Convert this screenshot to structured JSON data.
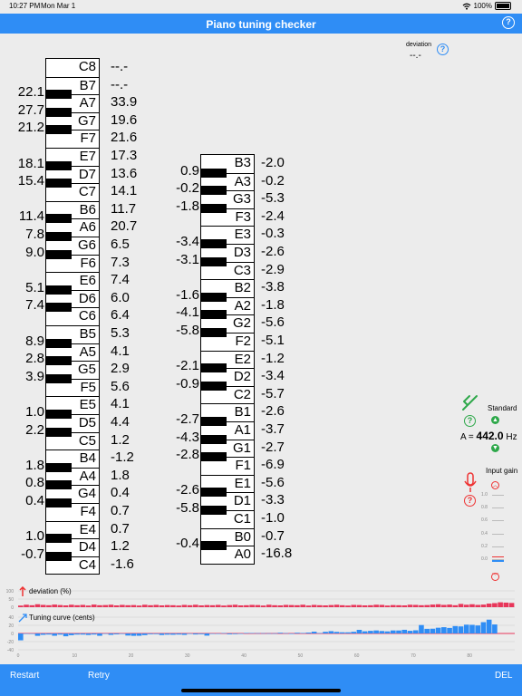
{
  "status_bar": {
    "time": "10:27 PM",
    "date": "Mon Mar 1",
    "battery": "100%"
  },
  "title": "Piano tuning checker",
  "help_symbol": "?",
  "deviation": {
    "label": "deviation",
    "value": "--.-"
  },
  "column1": {
    "keys": [
      "C8",
      "B7",
      "A7",
      "G7",
      "F7",
      "E7",
      "D7",
      "C7",
      "B6",
      "A6",
      "G6",
      "F6",
      "E6",
      "D6",
      "C6",
      "B5",
      "A5",
      "G5",
      "F5",
      "E5",
      "D5",
      "C5",
      "B4",
      "A4",
      "G4",
      "F4",
      "E4",
      "D4",
      "C4"
    ],
    "white_values": [
      "--.-",
      "--.-",
      "33.9",
      "19.6",
      "21.6",
      "17.3",
      "13.6",
      "14.1",
      "11.7",
      "20.7",
      "6.5",
      "7.3",
      "7.4",
      "6.0",
      "6.4",
      "5.3",
      "4.1",
      "2.9",
      "5.6",
      "4.1",
      "4.4",
      "1.2",
      "-1.2",
      "1.8",
      "0.4",
      "0.7",
      "0.7",
      "1.2",
      "-1.6"
    ],
    "black_values": [
      "22.1",
      "27.7",
      "21.2",
      "18.1",
      "15.4",
      "11.4",
      "7.8",
      "9.0",
      "5.1",
      "7.4",
      "8.9",
      "2.8",
      "3.9",
      "1.0",
      "2.2",
      "1.8",
      "0.8",
      "0.4",
      "1.0",
      "-0.7"
    ]
  },
  "column2": {
    "keys": [
      "B3",
      "A3",
      "G3",
      "F3",
      "E3",
      "D3",
      "C3",
      "B2",
      "A2",
      "G2",
      "F2",
      "E2",
      "D2",
      "C2",
      "B1",
      "A1",
      "G1",
      "F1",
      "E1",
      "D1",
      "C1",
      "B0",
      "A0"
    ],
    "white_values": [
      "-2.0",
      "-0.2",
      "-5.3",
      "-2.4",
      "-0.3",
      "-2.6",
      "-2.9",
      "-3.8",
      "-1.8",
      "-5.6",
      "-5.1",
      "-1.2",
      "-3.4",
      "-5.7",
      "-2.6",
      "-3.7",
      "-2.7",
      "-6.9",
      "-5.6",
      "-3.3",
      "-1.0",
      "-0.7",
      "-16.8"
    ],
    "black_values": [
      "0.9",
      "-0.2",
      "-1.8",
      "-3.4",
      "-3.1",
      "-1.6",
      "-4.1",
      "-5.8",
      "-2.1",
      "-0.9",
      "-2.7",
      "-4.3",
      "-2.8",
      "-2.6",
      "-5.8",
      "-0.4"
    ]
  },
  "standard": {
    "label": "Standard",
    "a_label": "A =",
    "frequency": "442.0",
    "unit": "Hz",
    "icon": "tuning-fork-icon"
  },
  "input_gain": {
    "label": "Input gain",
    "ticks": [
      "1.0",
      "0.8",
      "0.6",
      "0.4",
      "0.2",
      "0.0"
    ],
    "level": 0.0,
    "icon": "microphone-icon"
  },
  "deviation_chart": {
    "label": "deviation (%)",
    "y_ticks": [
      "100",
      "50",
      "0"
    ]
  },
  "tuning_chart": {
    "label": "Tuning curve (cents)",
    "y_ticks": [
      "40",
      "20",
      "0",
      "-20",
      "-40"
    ],
    "x_ticks": [
      "0",
      "10",
      "20",
      "30",
      "40",
      "50",
      "60",
      "70",
      "80"
    ]
  },
  "bottom_bar": {
    "restart": "Restart",
    "retry": "Retry",
    "del": "DEL"
  },
  "colors": {
    "accent": "#2f8df5",
    "red": "#e8365a",
    "green": "#2ea84a"
  },
  "chart_data": [
    {
      "type": "bar",
      "title": "deviation (%)",
      "ylim": [
        0,
        100
      ],
      "x": "key index 1-88",
      "values": [
        10,
        15,
        12,
        18,
        14,
        12,
        16,
        13,
        11,
        15,
        12,
        14,
        10,
        16,
        12,
        13,
        15,
        11,
        14,
        12,
        13,
        10,
        15,
        12,
        14,
        11,
        13,
        12,
        10,
        14,
        12,
        15,
        11,
        13,
        12,
        14,
        10,
        13,
        15,
        11,
        12,
        14,
        13,
        10,
        15,
        12,
        11,
        14,
        13,
        12,
        15,
        10,
        14,
        12,
        11,
        13,
        15,
        12,
        10,
        14,
        13,
        11,
        12,
        15,
        14,
        10,
        13,
        12,
        11,
        15,
        14,
        12,
        13,
        16,
        18,
        14,
        16,
        12,
        20,
        15,
        18,
        14,
        16,
        22,
        25,
        30,
        28,
        26
      ]
    },
    {
      "type": "bar",
      "title": "Tuning curve (cents)",
      "ylim": [
        -40,
        40
      ],
      "xlim": [
        0,
        88
      ],
      "values": [
        -16.8,
        -0.7,
        -1.0,
        -5.8,
        -3.3,
        -2.6,
        -5.6,
        -2.8,
        -6.9,
        -4.3,
        -2.7,
        -2.7,
        -3.7,
        -2.6,
        -5.7,
        -0.9,
        -3.4,
        -2.1,
        -1.2,
        -5.1,
        -5.8,
        -5.6,
        -4.1,
        -1.8,
        -1.6,
        -3.8,
        -2.9,
        -3.1,
        -2.6,
        -3.4,
        -0.3,
        -2.4,
        -1.8,
        -5.3,
        -0.2,
        -0.2,
        0.9,
        -2.0,
        -1.6,
        -0.7,
        1.2,
        1.0,
        0.7,
        0.7,
        0.4,
        0.4,
        1.8,
        0.8,
        -1.2,
        1.8,
        1.2,
        2.2,
        4.4,
        1.0,
        4.1,
        5.6,
        3.9,
        2.9,
        2.8,
        4.1,
        8.9,
        5.3,
        6.4,
        7.4,
        6.0,
        5.1,
        7.4,
        7.3,
        9.0,
        6.5,
        7.8,
        20.7,
        11.4,
        11.7,
        14.1,
        15.4,
        13.6,
        18.1,
        17.3,
        21.6,
        21.2,
        19.6,
        27.7,
        33.9,
        22.1
      ]
    }
  ]
}
